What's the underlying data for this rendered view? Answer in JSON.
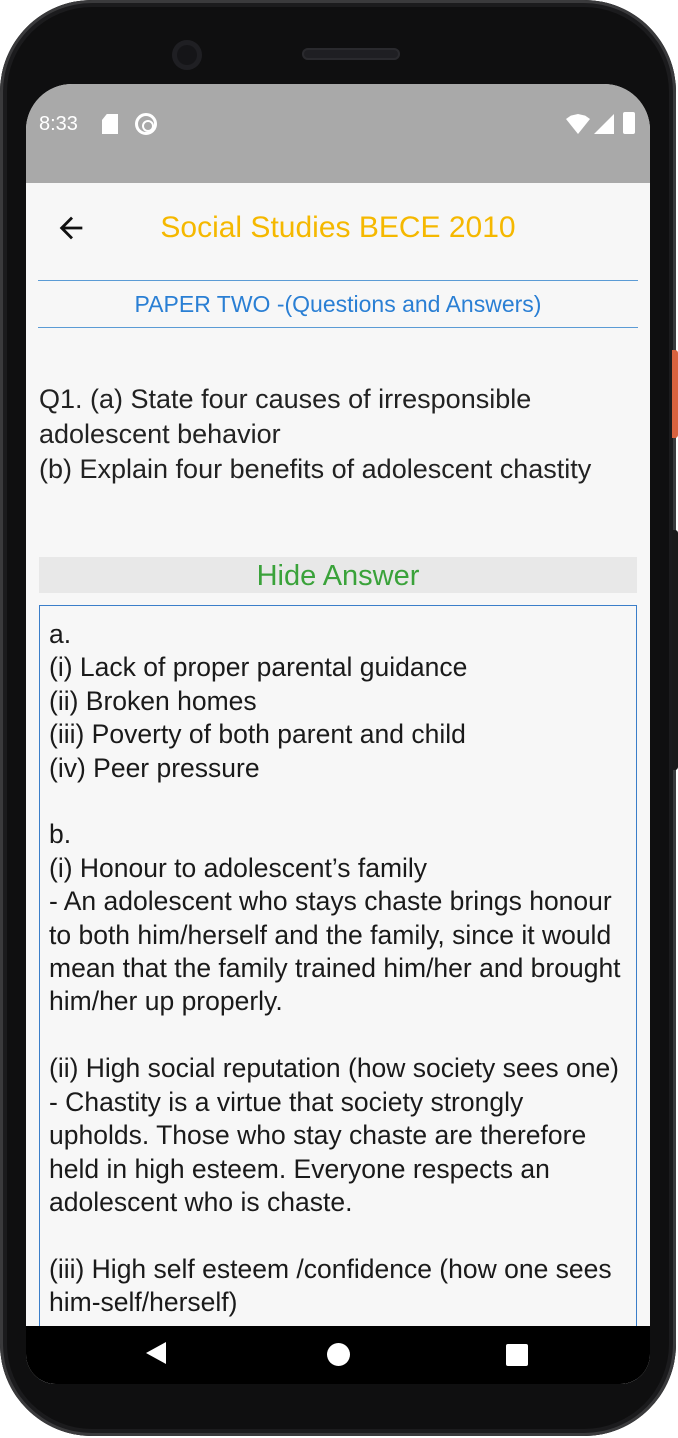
{
  "status_bar": {
    "time": "8:33",
    "icons": [
      "sd-card-icon",
      "sync-icon",
      "wifi-icon",
      "signal-icon",
      "battery-icon"
    ]
  },
  "app_bar": {
    "back_icon": "arrow-left-icon",
    "title": "Social Studies BECE 2010"
  },
  "subtitle": "PAPER TWO -(Questions and Answers)",
  "question": "Q1. (a) State four causes of irresponsible adolescent behavior\n(b) Explain four benefits of adolescent chastity",
  "toggle_answer_label": "Hide Answer",
  "answer": "a.\n(i) Lack of proper parental guidance\n(ii) Broken homes\n(iii) Poverty of both parent and child\n(iv) Peer pressure\n\nb.\n(i) Honour to adolescent’s family\n- An adolescent who stays chaste brings honour to both him/herself and the family, since it would mean that the family trained him/her and brought him/her up properly.\n\n(ii) High social reputation (how society sees one)\n- Chastity is a virtue that society strongly upholds. Those who stay chaste are therefore held in high esteem. Everyone respects an adolescent who is chaste.\n\n(iii) High self esteem /confidence (how one sees him-self/herself)",
  "nav_bar": {
    "icons": [
      "nav-back-icon",
      "nav-home-icon",
      "nav-recents-icon"
    ]
  },
  "colors": {
    "title": "#f5b800",
    "subtitle": "#2a7fd4",
    "toggle": "#3aa23a",
    "status_bar": "#a9a9a9"
  }
}
